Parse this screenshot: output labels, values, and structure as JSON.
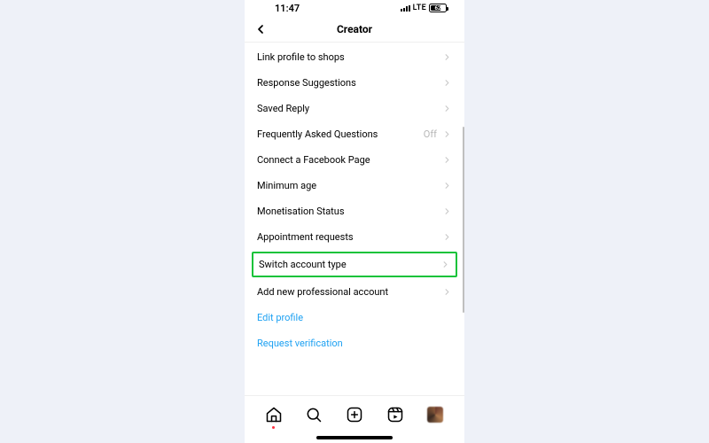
{
  "status": {
    "time": "11:47",
    "network": "LTE",
    "battery": "62"
  },
  "header": {
    "title": "Creator"
  },
  "rows": [
    {
      "label": "Link profile to shops",
      "status": "",
      "highlight": false
    },
    {
      "label": "Response Suggestions",
      "status": "",
      "highlight": false
    },
    {
      "label": "Saved Reply",
      "status": "",
      "highlight": false
    },
    {
      "label": "Frequently Asked Questions",
      "status": "Off",
      "highlight": false
    },
    {
      "label": "Connect a Facebook Page",
      "status": "",
      "highlight": false
    },
    {
      "label": "Minimum age",
      "status": "",
      "highlight": false
    },
    {
      "label": "Monetisation Status",
      "status": "",
      "highlight": false
    },
    {
      "label": "Appointment requests",
      "status": "",
      "highlight": false
    },
    {
      "label": "Switch account type",
      "status": "",
      "highlight": true
    },
    {
      "label": "Add new professional account",
      "status": "",
      "highlight": false
    }
  ],
  "links": [
    {
      "label": "Edit profile"
    },
    {
      "label": "Request verification"
    }
  ]
}
